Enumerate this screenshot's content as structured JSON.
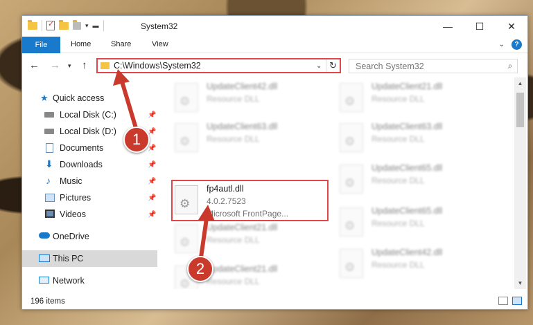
{
  "window": {
    "title": "System32",
    "controls": {
      "minimize": "—",
      "maximize": "☐",
      "close": "✕"
    }
  },
  "ribbon": {
    "tabs": [
      "File",
      "Home",
      "Share",
      "View"
    ],
    "help": "?"
  },
  "address": {
    "path": "C:\\Windows\\System32",
    "search_placeholder": "Search System32"
  },
  "nav": {
    "items": [
      {
        "label": "Quick access",
        "icon": "star-icon",
        "pinned": false
      },
      {
        "label": "Local Disk (C:)",
        "icon": "drive-icon",
        "pinned": true
      },
      {
        "label": "Local Disk (D:)",
        "icon": "drive-icon",
        "pinned": true
      },
      {
        "label": "Documents",
        "icon": "documents-icon",
        "pinned": true
      },
      {
        "label": "Downloads",
        "icon": "downloads-icon",
        "pinned": true
      },
      {
        "label": "Music",
        "icon": "music-icon",
        "pinned": true
      },
      {
        "label": "Pictures",
        "icon": "pictures-icon",
        "pinned": true
      },
      {
        "label": "Videos",
        "icon": "videos-icon",
        "pinned": true
      },
      {
        "label": "OneDrive",
        "icon": "cloud-icon",
        "pinned": false
      },
      {
        "label": "This PC",
        "icon": "computer-icon",
        "pinned": false
      },
      {
        "label": "Network",
        "icon": "network-icon",
        "pinned": false
      }
    ]
  },
  "files": [
    {
      "name": "UpdateClient42.dll",
      "line2": "Resource DLL",
      "line3": ""
    },
    {
      "name": "UpdateClient21.dll",
      "line2": "Resource DLL",
      "line3": ""
    },
    {
      "name": "UpdateClient63.dll",
      "line2": "Resource DLL",
      "line3": ""
    },
    {
      "name": "UpdateClient63.dll",
      "line2": "Resource DLL",
      "line3": ""
    },
    {
      "name": "fp4autl.dll",
      "line2": "4.0.2.7523",
      "line3": "Microsoft FrontPage..."
    },
    {
      "name": "UpdateClient65.dll",
      "line2": "Resource DLL",
      "line3": ""
    },
    {
      "name": "UpdateClient21.dll",
      "line2": "Resource DLL",
      "line3": ""
    },
    {
      "name": "UpdateClient65.dll",
      "line2": "Resource DLL",
      "line3": ""
    },
    {
      "name": "UpdateClient21.dll",
      "line2": "Resource DLL",
      "line3": ""
    },
    {
      "name": "UpdateClient42.dll",
      "line2": "Resource DLL",
      "line3": ""
    }
  ],
  "status": {
    "item_count": "196 items"
  },
  "callouts": [
    "1",
    "2"
  ],
  "colors": {
    "accent": "#1979ca",
    "highlight": "#e0454a",
    "callout": "#c93a2d"
  }
}
